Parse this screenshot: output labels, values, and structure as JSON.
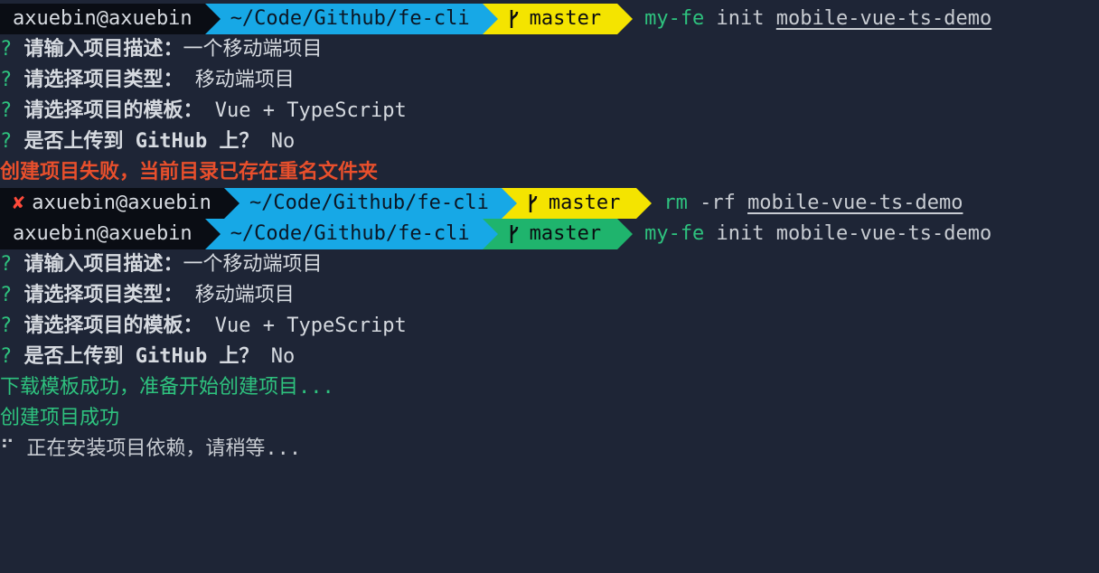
{
  "prompt1": {
    "user": "axuebin@axuebin",
    "path": "~/Code/Github/fe-cli",
    "branch": "master",
    "cmd_name": "my-fe",
    "cmd_arg": " init ",
    "cmd_target": "mobile-vue-ts-demo"
  },
  "session1": [
    {
      "mark": "? ",
      "question": "请输入项目描述：",
      "answer": "一个移动端项目"
    },
    {
      "mark": "? ",
      "question": "请选择项目类型：",
      "answer": " 移动端项目"
    },
    {
      "mark": "? ",
      "question": "请选择项目的模板：",
      "answer": " Vue + TypeScript"
    },
    {
      "mark": "? ",
      "question": "是否上传到 GitHub 上？",
      "answer": " No"
    }
  ],
  "error_line": "创建项目失败，当前目录已存在重名文件夹",
  "prompt2": {
    "fail_mark": "✘",
    "user": "axuebin@axuebin",
    "path": "~/Code/Github/fe-cli",
    "branch": "master",
    "cmd_name": "rm",
    "cmd_arg": " -rf ",
    "cmd_target": "mobile-vue-ts-demo"
  },
  "prompt3": {
    "user": "axuebin@axuebin",
    "path": "~/Code/Github/fe-cli",
    "branch": "master",
    "cmd_name": "my-fe",
    "cmd_arg": " init mobile-vue-ts-demo"
  },
  "session2": [
    {
      "mark": "? ",
      "question": "请输入项目描述：",
      "answer": "一个移动端项目"
    },
    {
      "mark": "? ",
      "question": "请选择项目类型：",
      "answer": " 移动端项目"
    },
    {
      "mark": "? ",
      "question": "请选择项目的模板：",
      "answer": " Vue + TypeScript"
    },
    {
      "mark": "? ",
      "question": "是否上传到 GitHub 上？",
      "answer": " No"
    }
  ],
  "success_lines": [
    "下载模板成功，准备开始创建项目...",
    "创建项目成功"
  ],
  "spinner": {
    "glyph": "⠋",
    "text": " 正在安装项目依赖，请稍等..."
  },
  "colors": {
    "background": "#1e2536",
    "user_segment": "#0a0d14",
    "path_segment": "#17a8e6",
    "git_dirty_segment": "#f4e400",
    "git_clean_segment": "#1fb46d",
    "command": "#2ec27e",
    "error": "#e84f2c"
  }
}
